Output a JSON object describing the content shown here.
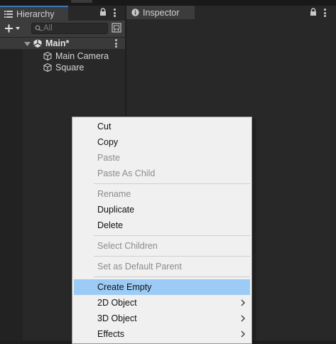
{
  "hierarchy": {
    "tab_label": "Hierarchy",
    "search_placeholder": "All",
    "scene_name": "Main*",
    "objects": [
      "Main Camera",
      "Square"
    ]
  },
  "inspector": {
    "tab_label": "Inspector"
  },
  "context_menu": {
    "items": [
      {
        "label": "Cut",
        "enabled": true
      },
      {
        "label": "Copy",
        "enabled": true
      },
      {
        "label": "Paste",
        "enabled": false
      },
      {
        "label": "Paste As Child",
        "enabled": false
      },
      {
        "label": "Rename",
        "enabled": false
      },
      {
        "label": "Duplicate",
        "enabled": true
      },
      {
        "label": "Delete",
        "enabled": true
      },
      {
        "label": "Select Children",
        "enabled": false
      },
      {
        "label": "Set as Default Parent",
        "enabled": false
      },
      {
        "label": "Create Empty",
        "enabled": true,
        "highlighted": true
      },
      {
        "label": "2D Object",
        "enabled": true,
        "submenu": true
      },
      {
        "label": "3D Object",
        "enabled": true,
        "submenu": true
      },
      {
        "label": "Effects",
        "enabled": true,
        "submenu": true
      }
    ]
  },
  "colors": {
    "accent": "#3a79bb",
    "menu_highlight": "#9ccbf5"
  }
}
